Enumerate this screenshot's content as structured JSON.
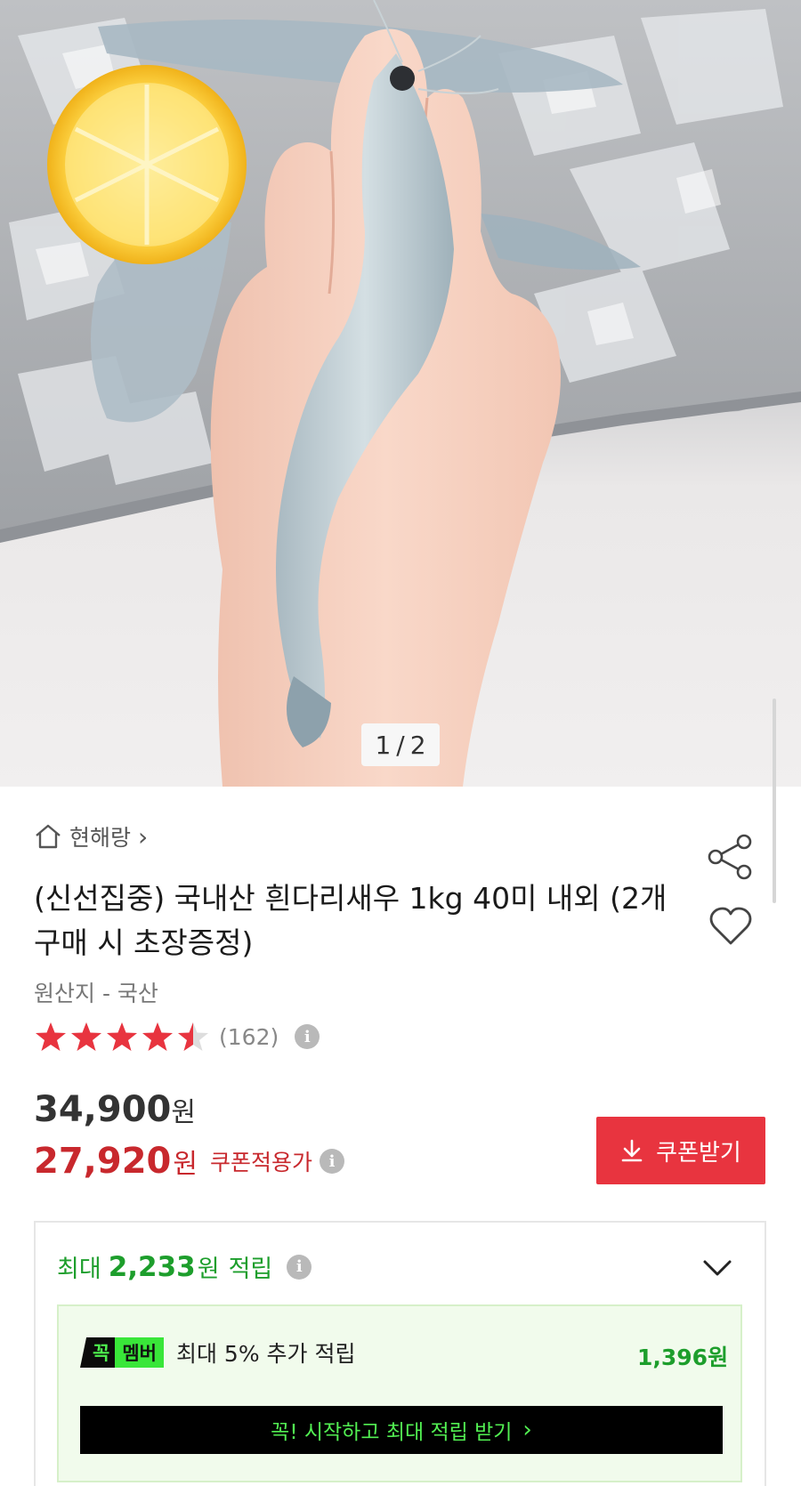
{
  "gallery": {
    "pager_current": "1",
    "pager_separator": "/",
    "pager_total": "2",
    "image_icon": "product-photo"
  },
  "store": {
    "icon": "home-icon",
    "name": "현해랑",
    "chevron": "›"
  },
  "product": {
    "title": "(신선집중) 국내산 흰다리새우 1kg 40미 내외 (2개 구매 시 초장증정)",
    "origin": "원산지 - 국산",
    "rating": 4.5,
    "review_count": "(162)",
    "info_icon": "i"
  },
  "actions": {
    "share_icon": "share-icon",
    "like_icon": "heart-icon"
  },
  "price": {
    "original": "34,900",
    "original_unit": "원",
    "sale": "27,920",
    "sale_unit": "원",
    "sale_label": "쿠폰적용가",
    "coupon_button": "쿠폰받기"
  },
  "points": {
    "prefix": "최대",
    "amount": "2,233",
    "unit": "원",
    "suffix": "적립",
    "member": {
      "badge_a": "꼭",
      "badge_b": "멤버",
      "text": "최대 5% 추가 적립",
      "amount": "1,396원",
      "cta": "꼭! 시작하고 최대 적립 받기",
      "cta_arrow": "›"
    }
  },
  "colors": {
    "sale_red": "#c8282d",
    "coupon_red": "#e8343f",
    "points_green": "#1d9e2c",
    "member_bg": "#f1fbec"
  }
}
